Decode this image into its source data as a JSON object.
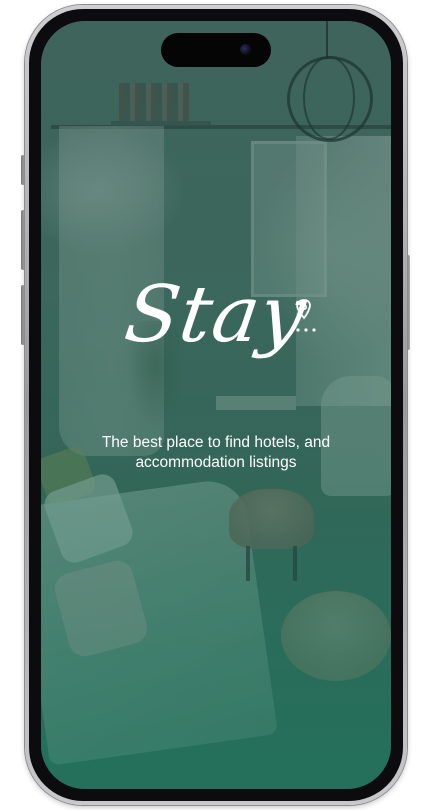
{
  "app": {
    "logo_text": "Stay",
    "tagline_line1": "The best place to find hotels, and",
    "tagline_line2": "accommodation listings"
  },
  "colors": {
    "overlay": "#2e6b5f",
    "text": "#ffffff",
    "phone_frame": "#b4b4b8"
  },
  "icons": {
    "logo_pin": "location-pin-icon",
    "camera": "front-camera-icon"
  }
}
